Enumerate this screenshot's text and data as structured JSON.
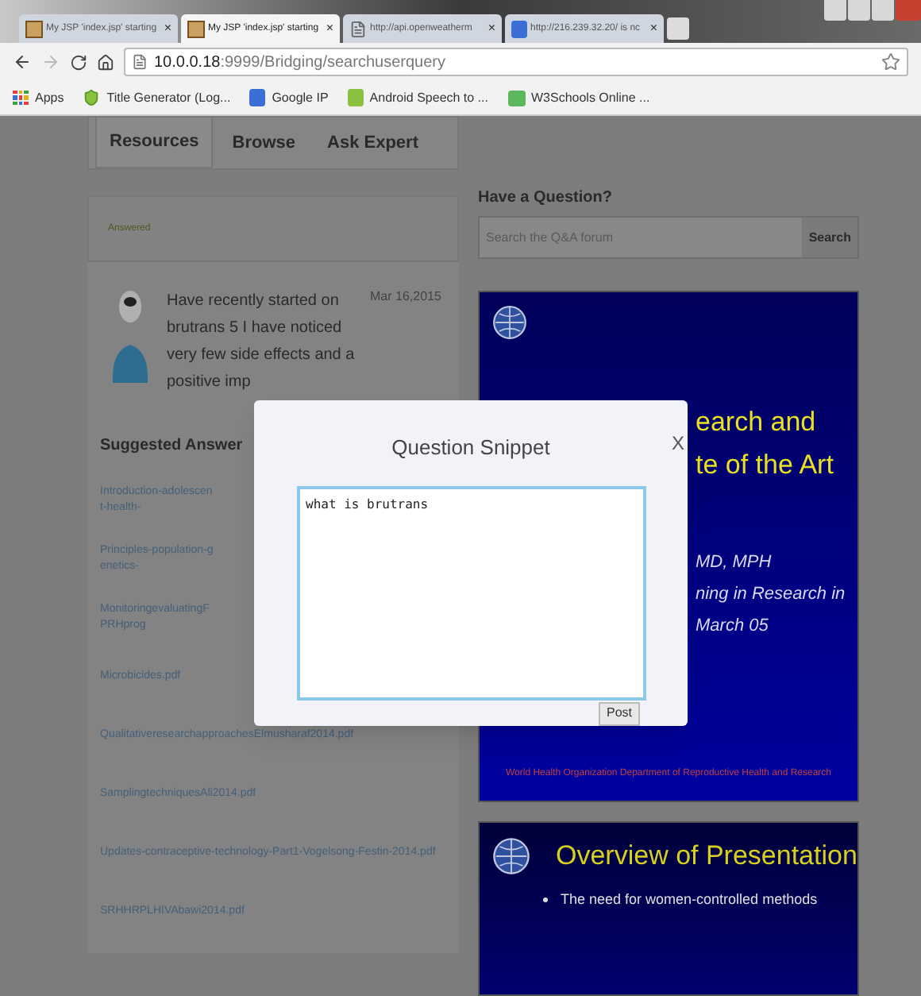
{
  "browser": {
    "tabs": [
      {
        "title": "My JSP 'index.jsp' starting",
        "selected": false
      },
      {
        "title": "My JSP 'index.jsp' starting",
        "selected": true
      },
      {
        "title": "http://api.openweatherm",
        "selected": false
      },
      {
        "title": "http://216.239.32.20/ is nc",
        "selected": false
      }
    ],
    "close_glyph": "×",
    "address": {
      "host": "10.0.0.18",
      "path": ":9999/Bridging/searchuserquery"
    },
    "bookmarks": [
      {
        "label": "Apps"
      },
      {
        "label": "Title Generator (Log..."
      },
      {
        "label": "Google IP"
      },
      {
        "label": "Android Speech to ..."
      },
      {
        "label": "W3Schools Online ..."
      }
    ]
  },
  "page": {
    "nav": [
      {
        "label": "Resources",
        "selected": true
      },
      {
        "label": "Browse",
        "selected": false
      },
      {
        "label": "Ask Expert",
        "selected": false
      }
    ],
    "status_label": "Answered",
    "question": {
      "text": "Have recently started on brutrans 5 I have noticed very few side effects and a positive imp",
      "date": "Mar 16,2015"
    },
    "suggested_heading": "Suggested Answer",
    "links": [
      "Introduction-adolescent-health-",
      "Principles-population-genetics-",
      "MonitoringevaluatingFPRHprog",
      "Microbicides.pdf",
      "QualitativeresearchapproachesElmusharaf2014.pdf",
      "SamplingtechniquesAli2014.pdf",
      "Updates-contraceptive-technology-Part1-Vogelsong-Festin-2014.pdf",
      "SRHHRPLHIVAbawi2014.pdf"
    ],
    "search": {
      "heading": "Have a Question?",
      "placeholder": "Search the Q&A forum",
      "button": "Search"
    },
    "slides": [
      {
        "kind": "title",
        "heading_lines": [
          "earch and",
          "te of the Art"
        ],
        "subtitle_lines": [
          "MD, MPH",
          "ning in Research in",
          "March 05"
        ],
        "footer": "World Health Organization Department of Reproductive Health and Research"
      },
      {
        "kind": "overview",
        "heading": "Overview of Presentation",
        "bullets": [
          "The need for women-controlled methods"
        ]
      }
    ]
  },
  "modal": {
    "title": "Question Snippet",
    "close": "X",
    "value": "what is brutrans",
    "button": "Post"
  }
}
